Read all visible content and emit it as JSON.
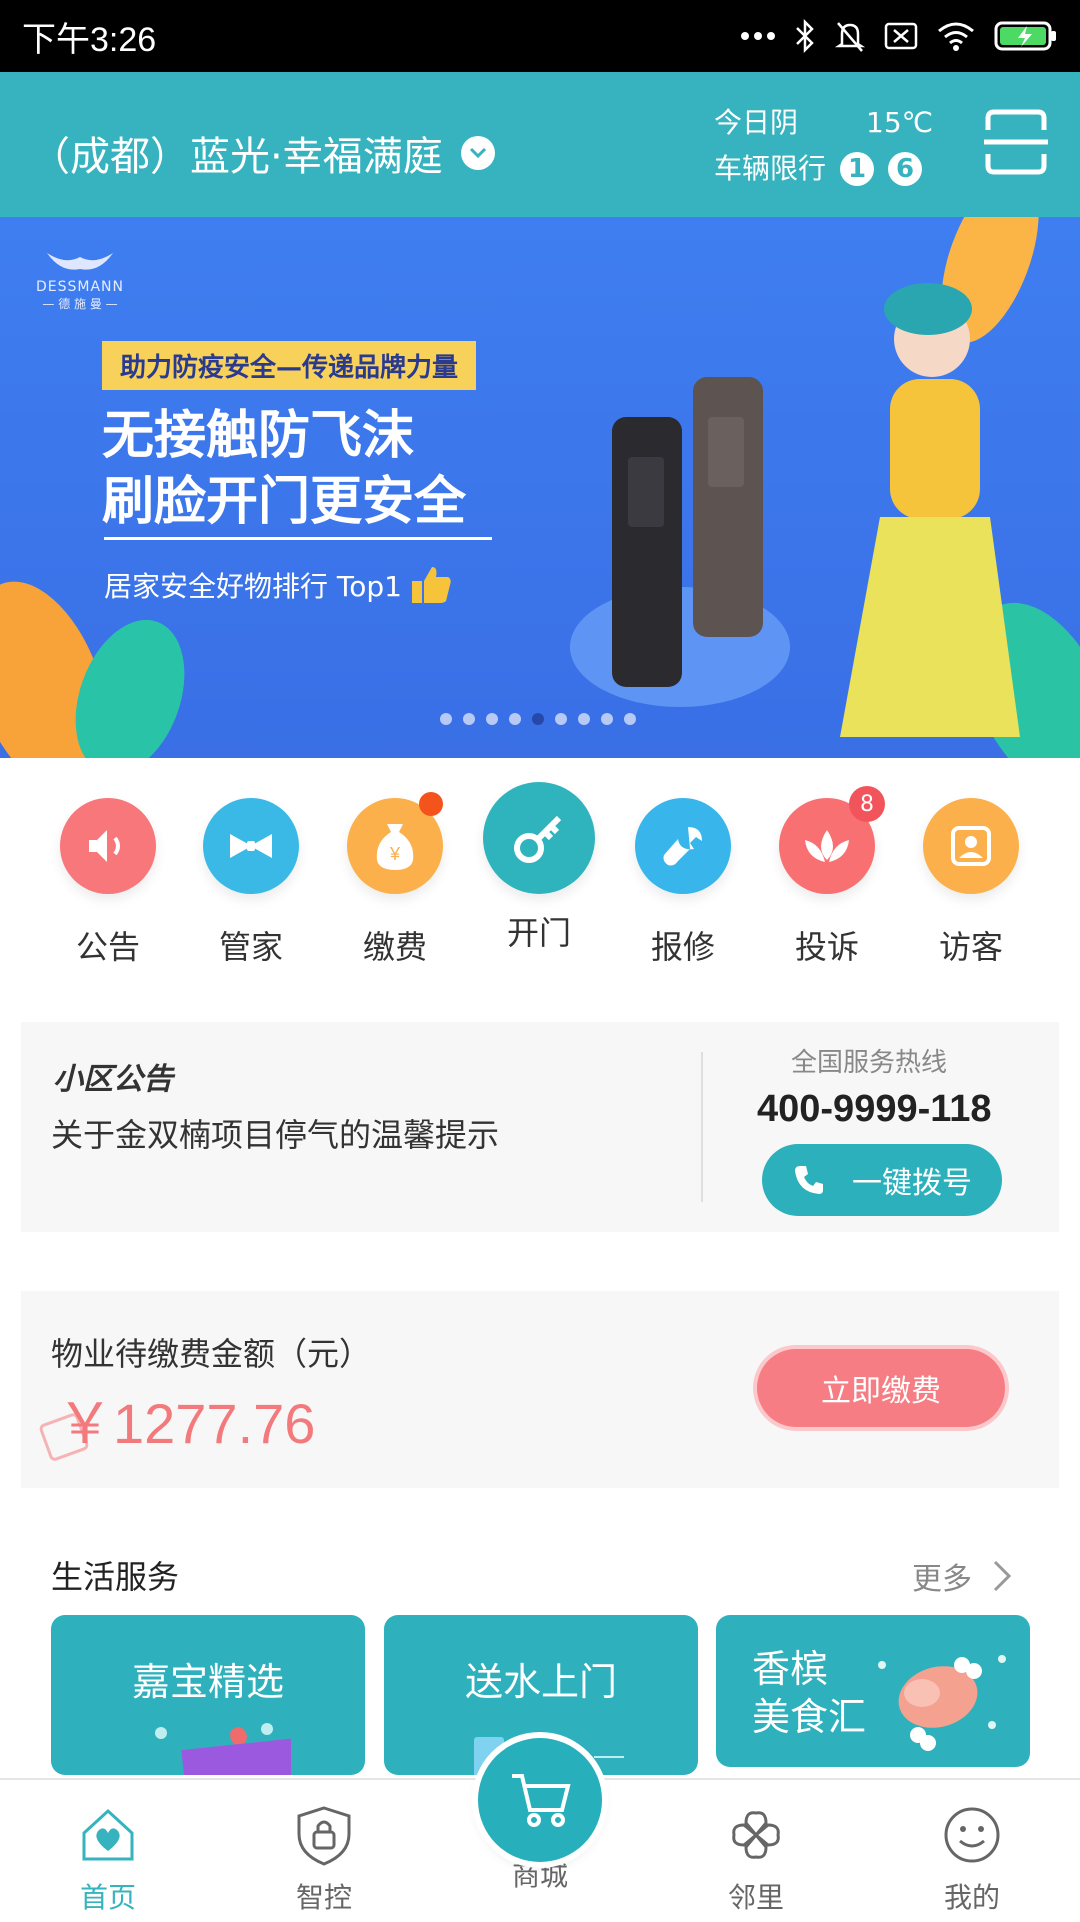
{
  "status_bar": {
    "time": "下午3:26"
  },
  "header": {
    "community": "（成都）蓝光·幸福满庭",
    "weather_label": "今日阴",
    "temperature": "15℃",
    "restriction_label": "车辆限行",
    "restriction_numbers": [
      "1",
      "6"
    ]
  },
  "banner": {
    "brand": "DESSMANN",
    "brand_cn": "— 德 施 曼 —",
    "tagline": "助力防疫安全—传递品牌力量",
    "headline_line1": "无接触防飞沫",
    "headline_line2": "刷脸开门更安全",
    "subline": "居家安全好物排行 Top1",
    "slide_count": 9,
    "active_slide": 5
  },
  "functions": [
    {
      "label": "公告",
      "color": "#f7777b",
      "icon": "speaker-icon"
    },
    {
      "label": "管家",
      "color": "#3bb9e6",
      "icon": "bowtie-icon"
    },
    {
      "label": "缴费",
      "color": "#fbb04b",
      "icon": "money-bag-icon",
      "badge_dot": true
    },
    {
      "label": "开门",
      "color": "#2fb4be",
      "icon": "key-icon"
    },
    {
      "label": "报修",
      "color": "#38b5ea",
      "icon": "wrench-icon"
    },
    {
      "label": "投诉",
      "color": "#f87072",
      "icon": "lotus-icon",
      "badge": "8"
    },
    {
      "label": "访客",
      "color": "#fbb04b",
      "icon": "visitor-icon"
    }
  ],
  "notice": {
    "title": "小区公告",
    "text": "关于金双楠项目停气的温馨提示",
    "hotline_label": "全国服务热线",
    "hotline_number": "400-9999-118",
    "dial_label": "一键拨号"
  },
  "fee": {
    "title": "物业待缴费金额（元）",
    "amount": "￥1277.76",
    "pay_label": "立即缴费"
  },
  "life_services": {
    "title": "生活服务",
    "more": "更多",
    "cards": [
      "嘉宝精选",
      "送水上门",
      "香槟\n美食汇"
    ]
  },
  "tabbar": {
    "home": "首页",
    "control": "智控",
    "mall": "商城",
    "neighbor": "邻里",
    "mine": "我的"
  },
  "colors": {
    "theme": "#36b3be",
    "fee_red": "#f37a7c",
    "banner_blue": "#3b78ee"
  }
}
